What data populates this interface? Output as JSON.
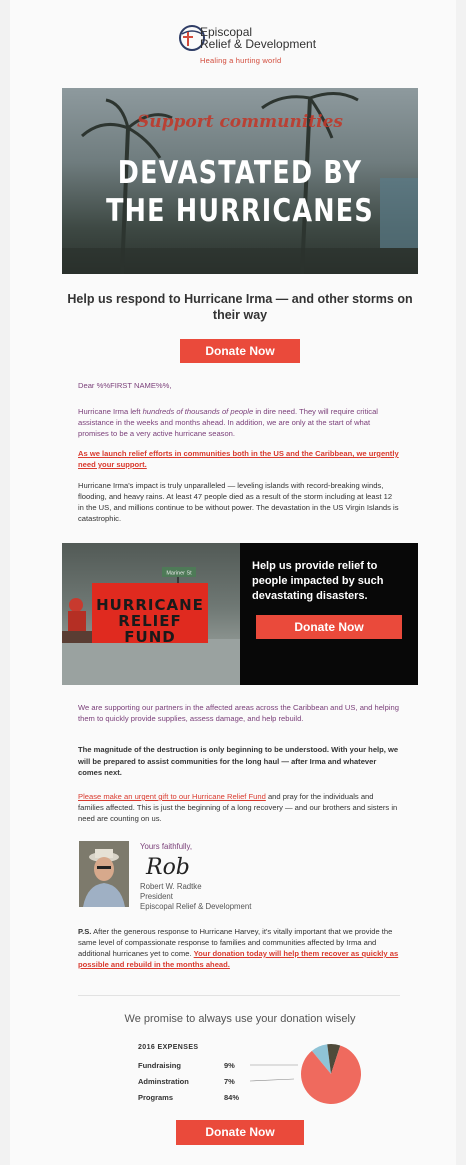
{
  "header": {
    "org_line1": "Episcopal",
    "org_line2": "Relief & Development",
    "tagline": "Healing a hurting world"
  },
  "hero": {
    "top_text": "Support communities",
    "title_line1": "DEVASTATED BY",
    "title_line2": "THE HURRICANES"
  },
  "subhead": "Help us respond to Hurricane Irma — and other storms on their way",
  "buttons": {
    "donate_1": "Donate Now",
    "donate_2": "Donate Now",
    "donate_3": "Donate Now"
  },
  "body": {
    "greeting": "Dear %%FIRST NAME%%,",
    "p1_start": "Hurricane Irma left ",
    "p1_italic": "hundreds of thousands of people",
    "p1_end": " in dire need. They will require critical assistance in the weeks and months ahead. In addition, we are only at the start of what promises to be a very active hurricane season.",
    "p2_link": "As we launch relief efforts in communities both in the US and the Caribbean, we urgently need your support.",
    "p3": "Hurricane Irma's impact is truly unparalleled — leveling islands with record-breaking winds, flooding, and heavy rains. At least 47 people died as a result of the storm including at least 12 in the US, and millions continue to be without power. The devastation in the US Virgin Islands is catastrophic.",
    "p4": "We are supporting our partners in the affected areas across the Caribbean and US, and helping them to quickly provide supplies, assess damage, and help rebuild.",
    "p5": "The magnitude of the destruction is only beginning to be understood. With your help, we will be prepared to assist communities for the long haul — after Irma and whatever comes next.",
    "p6_link": "Please make an urgent gift to our Hurricane Relief Fund",
    "p6_rest": " and pray for the individuals and families affected. This is just the beginning of a long recovery — and our brothers and sisters in need are counting on us.",
    "ps_label": "P.S.",
    "ps_text": " After the generous response to Hurricane Harvey, it's vitally important that we provide the same level of compassionate response to families and communities affected by Irma and additional hurricanes yet to come. ",
    "ps_link": "Your donation today will help them recover as quickly as possible and rebuild in the months ahead."
  },
  "relief": {
    "fund_line1": "HURRICANE",
    "fund_line2": "RELIEF FUND",
    "street_sign": "Mariner St",
    "text": "Help us provide relief to people impacted by such devastating disasters."
  },
  "signature": {
    "closing": "Yours faithfully,",
    "signature": "Rob",
    "name": "Robert W. Radtke",
    "title": "President",
    "org": "Episcopal Relief & Development"
  },
  "footer": {
    "promise": "We promise to always use your donation wisely"
  },
  "colors": {
    "accent_red": "#ea4a3b",
    "body_purple": "#7a3f79",
    "pie_red": "#ef6a5e",
    "pie_blue": "#8fc3d6",
    "pie_dark": "#4e4a3a"
  },
  "chart_data": {
    "type": "pie",
    "title": "2016 EXPENSES",
    "categories": [
      "Fundraising",
      "Adminstration",
      "Programs"
    ],
    "values": [
      9,
      7,
      84
    ],
    "labels": [
      "9%",
      "7%",
      "84%"
    ]
  }
}
